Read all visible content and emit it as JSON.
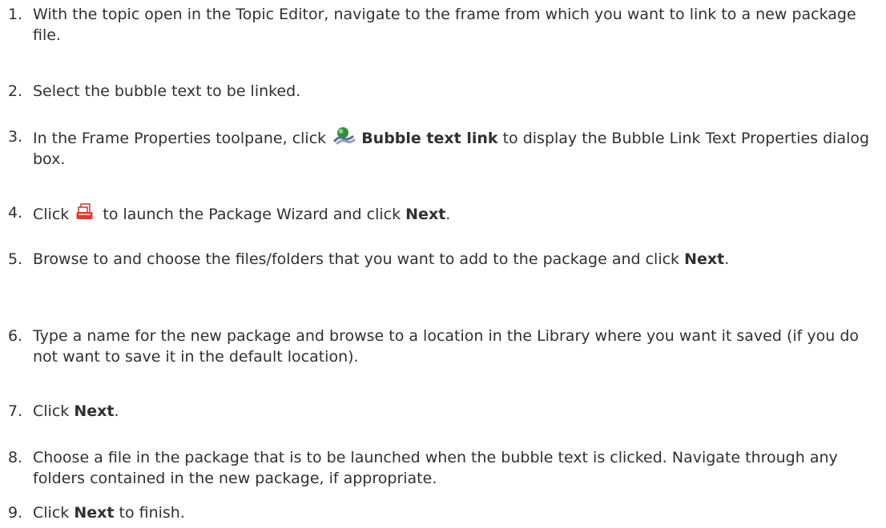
{
  "steps": [
    {
      "num": "1.",
      "t1": "With the topic open in the Topic Editor, navigate to the frame from which you want to link to a new package file."
    },
    {
      "num": "2.",
      "t1": "Select the bubble text to be linked."
    },
    {
      "num": "3.",
      "t1": "In the Frame Properties toolpane, click ",
      "icon": "bubble-text-link-icon",
      "bold": "Bubble text link",
      "t2": " to display the Bubble Link Text Properties dialog box."
    },
    {
      "num": "4.",
      "t1": "Click ",
      "icon": "package-wizard-icon",
      "t2": " to launch the Package Wizard and click ",
      "bold": "Next",
      "t3": "."
    },
    {
      "num": "5.",
      "t1": "Browse to and choose the files/folders that you want to add to the package and click ",
      "bold": "Next",
      "t2": "."
    },
    {
      "num": "6.",
      "t1": "Type a name for the new package and browse to a location in the Library where you want it saved (if you do not want to save it in the default location)."
    },
    {
      "num": "7.",
      "t1": "Click ",
      "bold": "Next",
      "t2": "."
    },
    {
      "num": "8.",
      "t1": "Choose a file in the package that is to be launched when the bubble text is clicked. Navigate through any folders contained in the new package, if appropriate."
    },
    {
      "num": "9.",
      "t1": "Click ",
      "bold": "Next",
      "t2": " to finish."
    }
  ]
}
